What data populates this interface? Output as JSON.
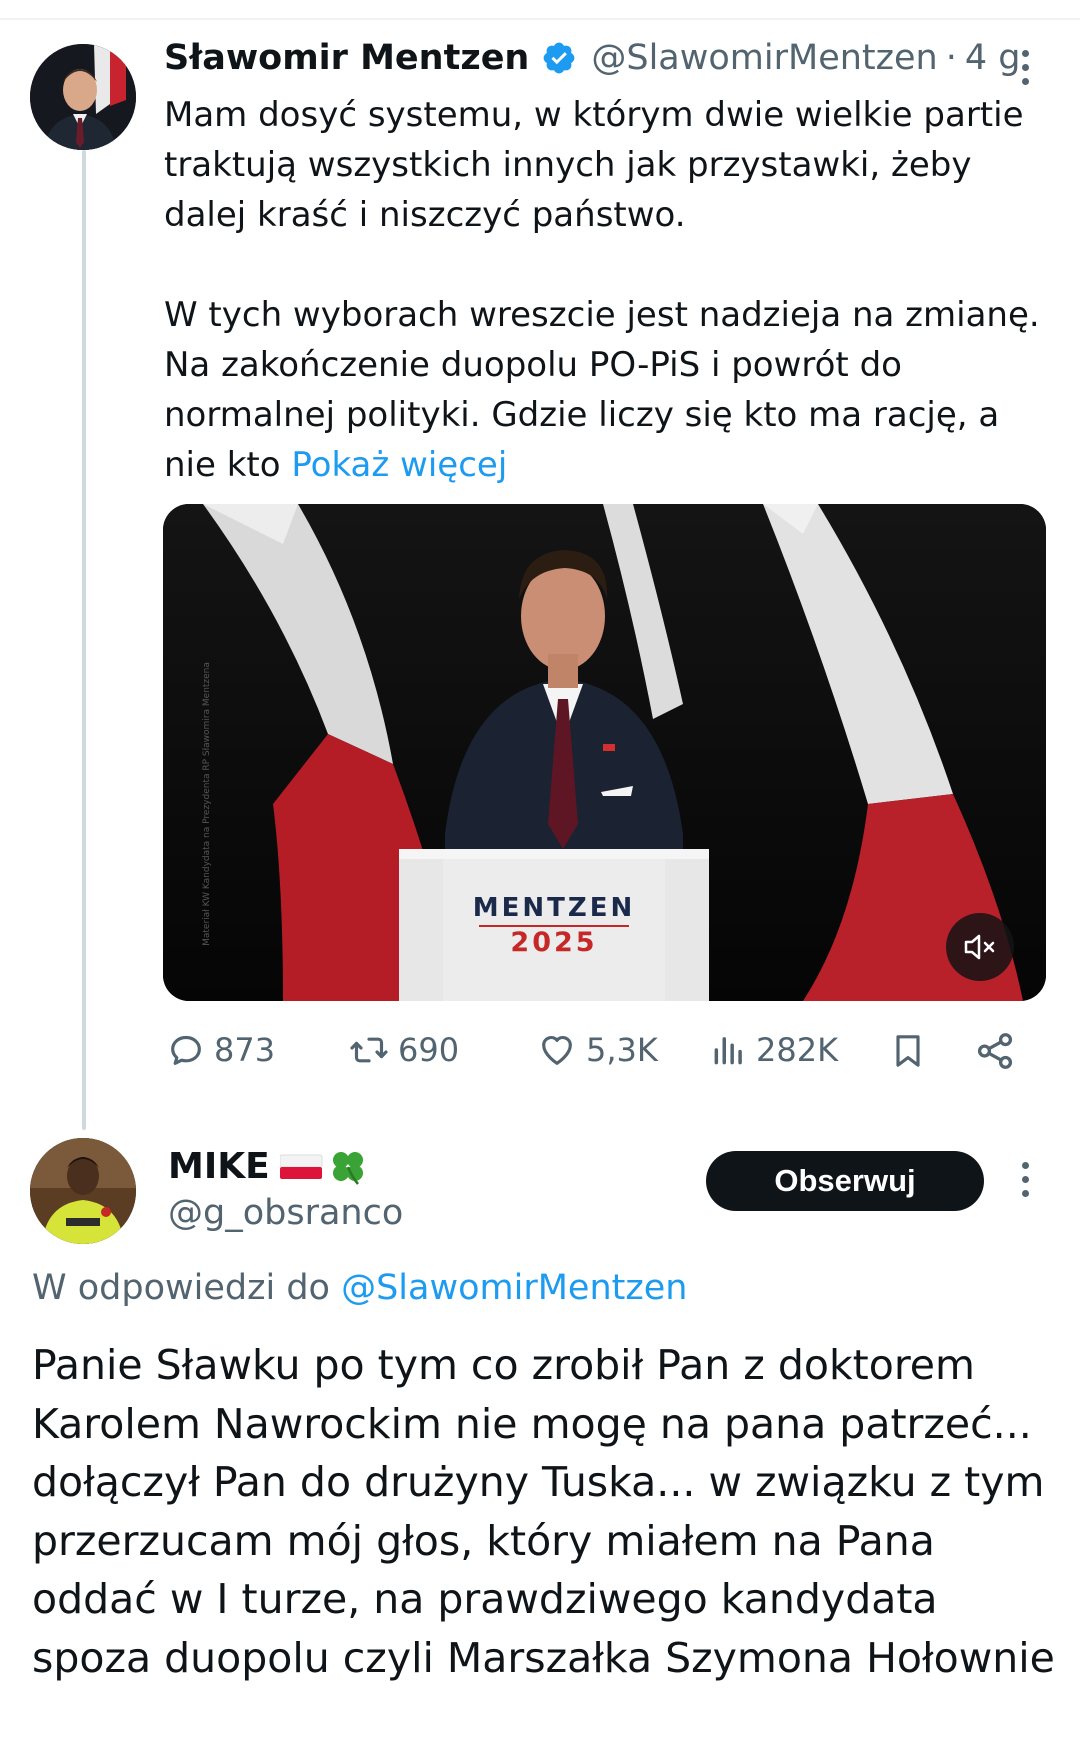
{
  "tweet": {
    "author_name": "Sławomir Mentzen",
    "author_handle": "@SlawomirMentzen",
    "separator": "·",
    "time": "4 g.",
    "paragraph1": "Mam dosyć systemu, w którym dwie wielkie partie traktują wszystkich innych jak przystawki, żeby dalej kraść i niszczyć państwo.",
    "paragraph2": "W tych wyborach wreszcie jest nadzieja na zmianę. Na zakończenie duopolu PO-PiS i powrót do normalnej polityki. Gdzie liczy się kto ma rację, a nie kto",
    "show_more": "Pokaż więcej",
    "media": {
      "podium_line1": "MENTZEN",
      "podium_line2": "2025",
      "watermark": "Materiał KW Kandydata na Prezydenta RP Sławomira Mentzena",
      "mute_icon": "speaker-muted-icon"
    },
    "stats": {
      "replies": "873",
      "reposts": "690",
      "likes": "5,3K",
      "views": "282K"
    },
    "colors": {
      "link": "#1d9bf0",
      "verified": "#1d9bf0",
      "secondary_text": "#536471"
    }
  },
  "reply": {
    "author_name": "MIKE",
    "author_handle": "@g_obsranco",
    "emoji": "flag-poland and four-leaf-clover",
    "follow_label": "Obserwuj",
    "in_reply_prefix": "W odpowiedzi do",
    "in_reply_mention": "@SlawomirMentzen",
    "text": "Panie Sławku po tym co zrobił Pan z doktorem Karolem Nawrockim nie mogę na pana patrzeć... dołączył Pan do drużyny Tuska... w związku z tym przerzucam mój głos, który miałem na Pana oddać w I turze, na prawdziwego kandydata spoza duopolu czyli Marszałka Szymona Hołownie"
  }
}
